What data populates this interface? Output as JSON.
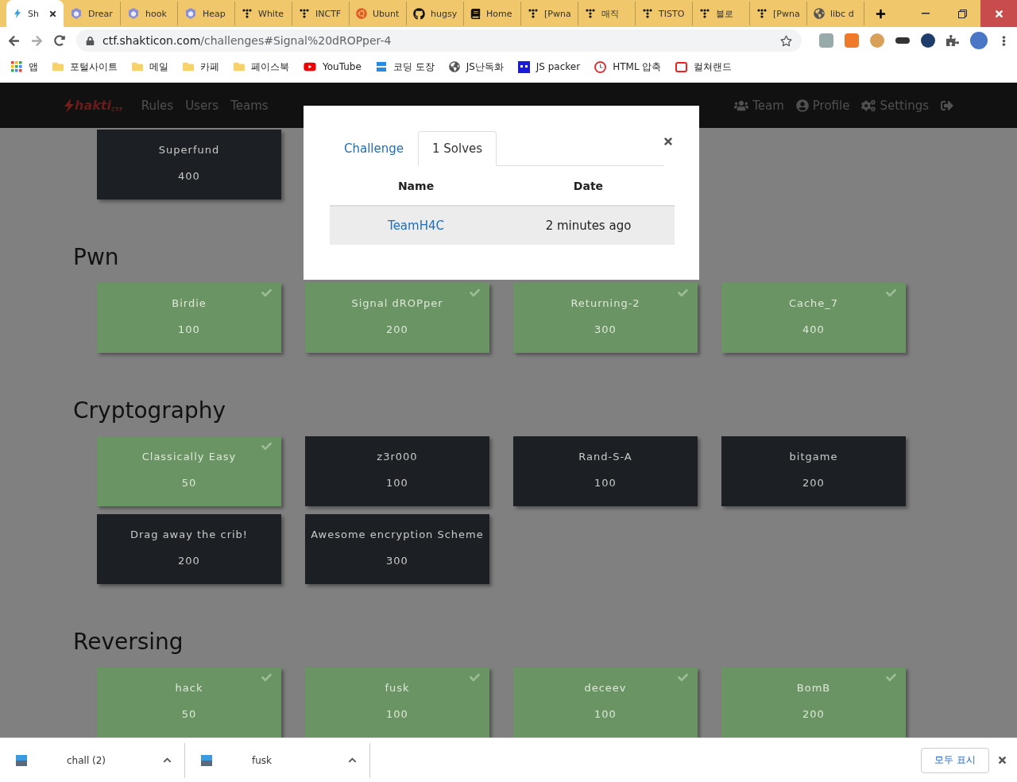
{
  "browser": {
    "tabs": [
      {
        "title": "Sh",
        "kind": "bolt",
        "selected": true
      },
      {
        "title": "Drear",
        "kind": "cube",
        "selected": false
      },
      {
        "title": "hook",
        "kind": "cube",
        "selected": false
      },
      {
        "title": "Heap",
        "kind": "cube",
        "selected": false
      },
      {
        "title": "White",
        "kind": "dots",
        "selected": false
      },
      {
        "title": "INCTF",
        "kind": "dots",
        "selected": false
      },
      {
        "title": "Ubunt",
        "kind": "ubuntu",
        "selected": false
      },
      {
        "title": "hugsy",
        "kind": "github",
        "selected": false
      },
      {
        "title": "Home",
        "kind": "book",
        "selected": false
      },
      {
        "title": "[Pwna",
        "kind": "dots",
        "selected": false
      },
      {
        "title": "매직",
        "kind": "dots",
        "selected": false
      },
      {
        "title": "TISTO",
        "kind": "dots",
        "selected": false
      },
      {
        "title": "블로",
        "kind": "dots",
        "selected": false
      },
      {
        "title": "[Pwna",
        "kind": "dots",
        "selected": false
      },
      {
        "title": "libc d",
        "kind": "globe",
        "selected": false
      }
    ],
    "url_host": "ctf.shakticon.com",
    "url_path": "/challenges#Signal%20dROPper-4",
    "bookmarks": [
      {
        "label": "앱",
        "kind": "apps"
      },
      {
        "label": "포털사이트",
        "kind": "folder"
      },
      {
        "label": "메일",
        "kind": "folder"
      },
      {
        "label": "카페",
        "kind": "folder"
      },
      {
        "label": "페이스북",
        "kind": "folder"
      },
      {
        "label": "YouTube",
        "kind": "youtube"
      },
      {
        "label": "코딩 도장",
        "kind": "coding"
      },
      {
        "label": "JS난독화",
        "kind": "globe"
      },
      {
        "label": "JS packer",
        "kind": "packer"
      },
      {
        "label": "HTML 압축",
        "kind": "clock"
      },
      {
        "label": "컬쳐랜드",
        "kind": "culture"
      }
    ]
  },
  "navbar": {
    "brand": "hakti",
    "brand_sub": "CTF",
    "left": [
      "Rules",
      "Users",
      "Teams"
    ],
    "right": [
      {
        "label": "Team",
        "kind": "users"
      },
      {
        "label": "Profile",
        "kind": "user"
      },
      {
        "label": "Settings",
        "kind": "cogs"
      },
      {
        "kind": "logout"
      }
    ]
  },
  "categories": [
    {
      "challenges": [
        {
          "name": "Superfund",
          "points": "400",
          "solved": false
        }
      ]
    },
    {
      "title": "Pwn",
      "challenges": [
        {
          "name": "Birdie",
          "points": "100",
          "solved": true
        },
        {
          "name": "Signal dROPper",
          "points": "200",
          "solved": true
        },
        {
          "name": "Returning-2",
          "points": "300",
          "solved": true
        },
        {
          "name": "Cache_7",
          "points": "400",
          "solved": true
        }
      ]
    },
    {
      "title": "Cryptography",
      "challenges": [
        {
          "name": "Classically Easy",
          "points": "50",
          "solved": true
        },
        {
          "name": "z3r000",
          "points": "100",
          "solved": false
        },
        {
          "name": "Rand-S-A",
          "points": "100",
          "solved": false
        },
        {
          "name": "bitgame",
          "points": "200",
          "solved": false
        },
        {
          "name": "Drag away the crib!",
          "points": "200",
          "solved": false
        },
        {
          "name": "Awesome encryption Scheme",
          "points": "300",
          "solved": false
        }
      ]
    },
    {
      "title": "Reversing",
      "challenges": [
        {
          "name": "hack",
          "points": "50",
          "solved": true
        },
        {
          "name": "fusk",
          "points": "100",
          "solved": true
        },
        {
          "name": "deceev",
          "points": "100",
          "solved": true
        },
        {
          "name": "BomB",
          "points": "200",
          "solved": true
        }
      ]
    }
  ],
  "modal": {
    "tabs": [
      {
        "label": "Challenge",
        "selected": false
      },
      {
        "label": "1 Solves",
        "selected": true
      }
    ],
    "columns": [
      "Name",
      "Date"
    ],
    "rows": [
      {
        "name": "TeamH4C",
        "date": "2 minutes ago"
      }
    ]
  },
  "downloads": {
    "items": [
      {
        "name": "chall (2)"
      },
      {
        "name": "fusk"
      }
    ],
    "show_all": "모두 표시"
  }
}
